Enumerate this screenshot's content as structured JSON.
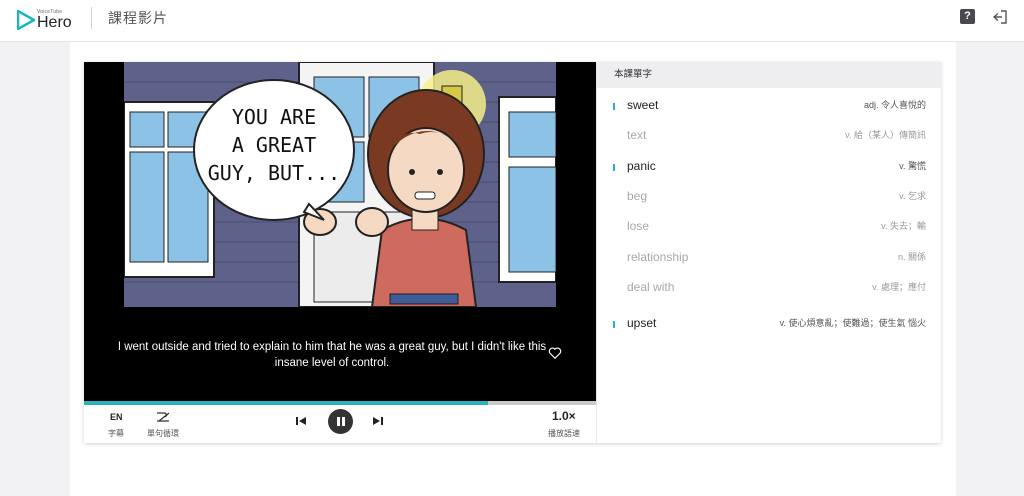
{
  "header": {
    "brand_small": "VoiceTube",
    "brand": "Hero",
    "title": "課程影片",
    "help_label": "?"
  },
  "video": {
    "speech_bubble_lines": [
      "YOU ARE",
      "A GREAT",
      "GUY, BUT..."
    ],
    "subtitle_line1": "I went outside and tried to explain to him that he was a great guy, but I didn't like this",
    "subtitle_line2": "insane level of control.",
    "progress_fraction": 0.79
  },
  "controls": {
    "subtitle_icon_text": "EN",
    "subtitle_label": "字幕",
    "loop_label": "單句循環",
    "speed_value": "1.0×",
    "speed_label": "播放語速"
  },
  "vocab": {
    "header": "本課單字",
    "items": [
      {
        "word": "sweet",
        "def": "adj.  令人喜悅的",
        "active": true
      },
      {
        "word": "text",
        "def": "v.  給（某人）傳簡訊",
        "active": false
      },
      {
        "word": "panic",
        "def": "v.  驚慌",
        "active": true
      },
      {
        "word": "beg",
        "def": "v.  乞求",
        "active": false
      },
      {
        "word": "lose",
        "def": "v.  失去；輸",
        "active": false
      },
      {
        "word": "relationship",
        "def": "n.  關係",
        "active": false
      },
      {
        "word": "deal with",
        "def": "v.  處理；應付",
        "active": false
      },
      {
        "word": "upset",
        "def": "v.  使心煩意亂；使難過；使生氣 惱火",
        "active": true
      }
    ]
  },
  "colors": {
    "accent": "#2bb3c0",
    "header_bg": "#ffffff",
    "page_bg": "#f2f2f4"
  }
}
